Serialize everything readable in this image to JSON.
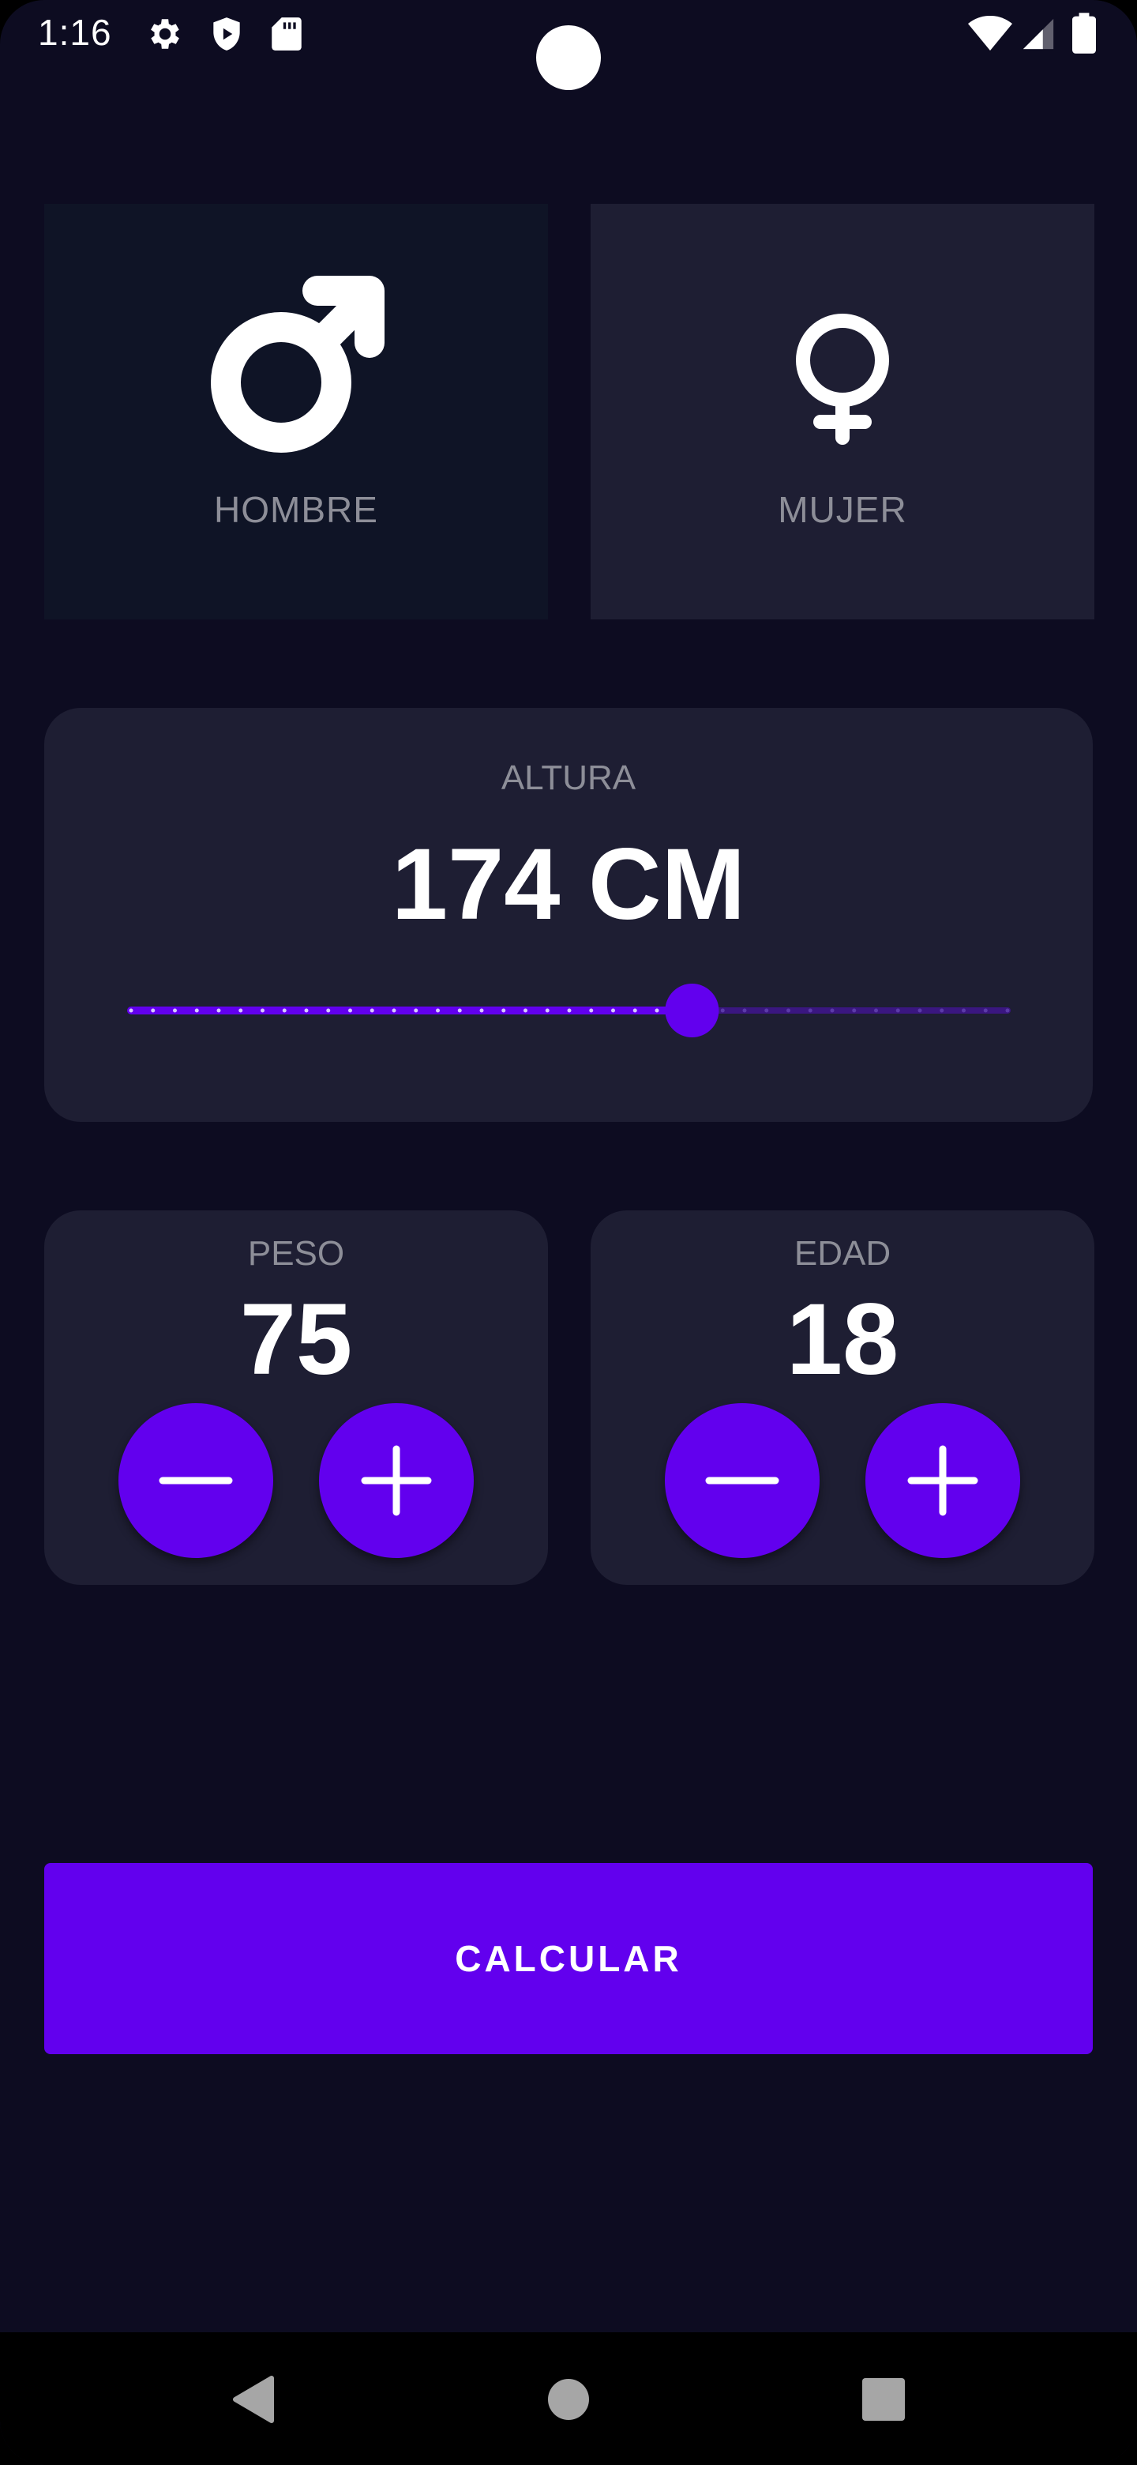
{
  "status_bar": {
    "time": "1:16",
    "icons": [
      "gear-icon",
      "shield-play-icon",
      "sd-card-icon",
      "wifi-icon",
      "signal-icon",
      "battery-icon"
    ]
  },
  "gender": {
    "male_label": "HOMBRE",
    "female_label": "MUJER",
    "selected": "male"
  },
  "height": {
    "label": "ALTURA",
    "value_text": "174 CM",
    "slider_value": 174,
    "slider_fraction": 0.64
  },
  "weight": {
    "label": "PESO",
    "value": "75"
  },
  "age": {
    "label": "EDAD",
    "value": "18"
  },
  "calculate_label": "CALCULAR",
  "colors": {
    "background": "#0d0c21",
    "card": "#1e1e33",
    "card_selected": "#0f1426",
    "accent": "#6200ee",
    "label": "#8d8e98",
    "text": "#ffffff"
  },
  "nav_icons": [
    "back-icon",
    "home-icon",
    "recents-icon"
  ]
}
